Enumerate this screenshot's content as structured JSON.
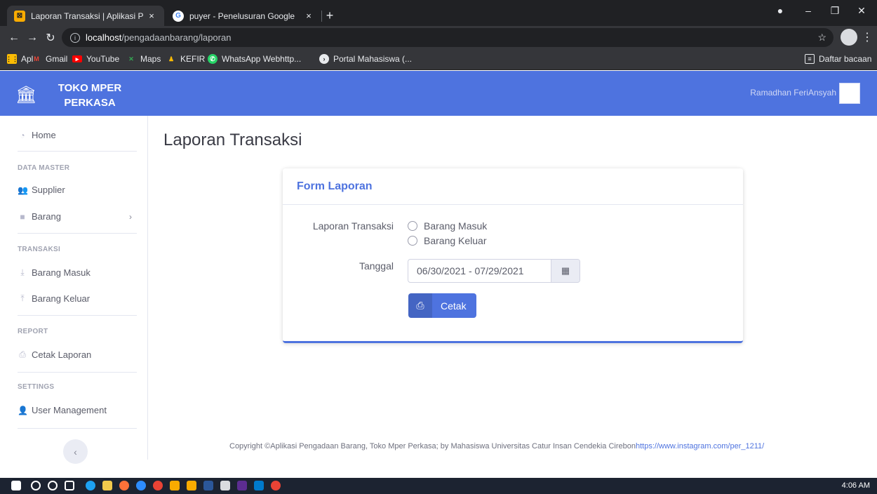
{
  "browser": {
    "tabs": [
      {
        "title": "Laporan Transaksi | Aplikasi Peng",
        "close": "×"
      },
      {
        "title": "puyer - Penelusuran Google",
        "close": "×"
      }
    ],
    "new_tab": "+",
    "url_host": "localhost",
    "url_path": "/pengadaanbarang/laporan",
    "bookmarks": [
      "Apl",
      "Gmail",
      "YouTube",
      "Maps",
      "KEFIR",
      "WhatsApp Webhttp...",
      "Portal Mahasiswa (..."
    ],
    "reading_list": "Daftar bacaan"
  },
  "header": {
    "brand_line1": "TOKO MPER",
    "brand_line2": "PERKASA",
    "user_name": "Ramadhan FeriAnsyah"
  },
  "sidebar": {
    "home": "Home",
    "section_master": "DATA MASTER",
    "supplier": "Supplier",
    "barang": "Barang",
    "section_transaksi": "TRANSAKSI",
    "barang_masuk": "Barang Masuk",
    "barang_keluar": "Barang Keluar",
    "section_report": "REPORT",
    "cetak_laporan": "Cetak Laporan",
    "section_settings": "SETTINGS",
    "user_management": "User Management"
  },
  "main": {
    "page_title": "Laporan Transaksi",
    "card_title": "Form Laporan",
    "label_laporan": "Laporan Transaksi",
    "option_masuk": "Barang Masuk",
    "option_keluar": "Barang Keluar",
    "label_tanggal": "Tanggal",
    "date_range": "06/30/2021 - 07/29/2021",
    "button_cetak": "Cetak"
  },
  "footer": {
    "text": "Copyright ©Aplikasi Pengadaan Barang, Toko Mper Perkasa; by Mahasiswa Universitas Catur Insan Cendekia Cirebon",
    "link": "https://www.instagram.com/per_1211/"
  },
  "taskbar": {
    "time": "4:06 AM"
  },
  "colors": {
    "primary": "#4e73df",
    "header": "#4e73df",
    "chrome_dark": "#202124"
  }
}
